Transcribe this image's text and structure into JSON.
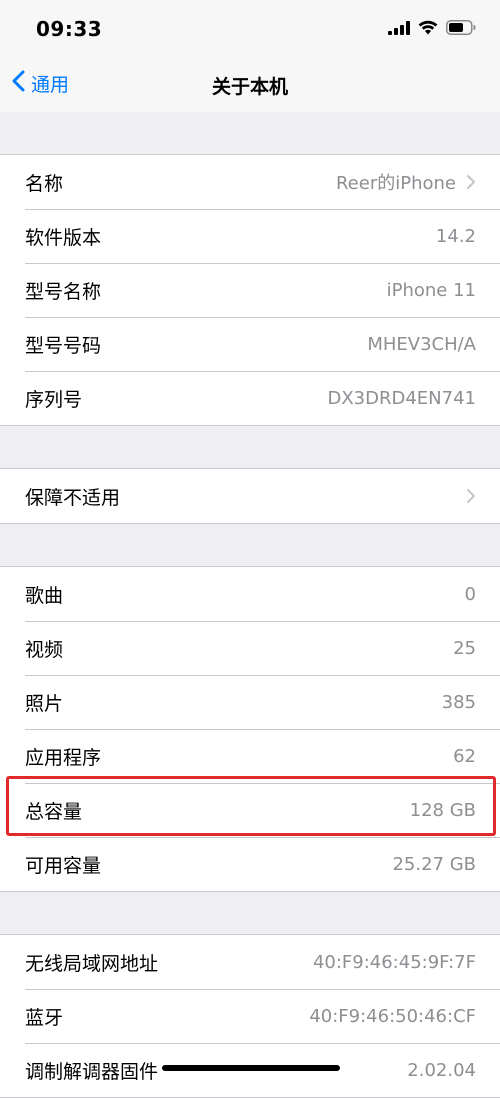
{
  "status_bar": {
    "time": "09:33"
  },
  "nav": {
    "back_label": "通用",
    "title": "关于本机"
  },
  "groups": [
    {
      "rows": [
        {
          "label": "名称",
          "value": "Reer的iPhone",
          "chevron": true
        },
        {
          "label": "软件版本",
          "value": "14.2",
          "chevron": false
        },
        {
          "label": "型号名称",
          "value": "iPhone 11",
          "chevron": false
        },
        {
          "label": "型号号码",
          "value": "MHEV3CH/A",
          "chevron": false
        },
        {
          "label": "序列号",
          "value": "DX3DRD4EN741",
          "chevron": false
        }
      ]
    },
    {
      "rows": [
        {
          "label": "保障不适用",
          "value": "",
          "chevron": true
        }
      ]
    },
    {
      "rows": [
        {
          "label": "歌曲",
          "value": "0",
          "chevron": false
        },
        {
          "label": "视频",
          "value": "25",
          "chevron": false
        },
        {
          "label": "照片",
          "value": "385",
          "chevron": false
        },
        {
          "label": "应用程序",
          "value": "62",
          "chevron": false
        },
        {
          "label": "总容量",
          "value": "128 GB",
          "chevron": false
        },
        {
          "label": "可用容量",
          "value": "25.27 GB",
          "chevron": false
        }
      ]
    },
    {
      "rows": [
        {
          "label": "无线局域网地址",
          "value": "40:F9:46:45:9F:7F",
          "chevron": false
        },
        {
          "label": "蓝牙",
          "value": "40:F9:46:50:46:CF",
          "chevron": false
        },
        {
          "label": "调制解调器固件",
          "value": "2.02.04",
          "chevron": false
        }
      ]
    }
  ],
  "colors": {
    "accent": "#007aff",
    "highlight_border": "#e02a2a",
    "secondary_text": "#8e8e93"
  }
}
